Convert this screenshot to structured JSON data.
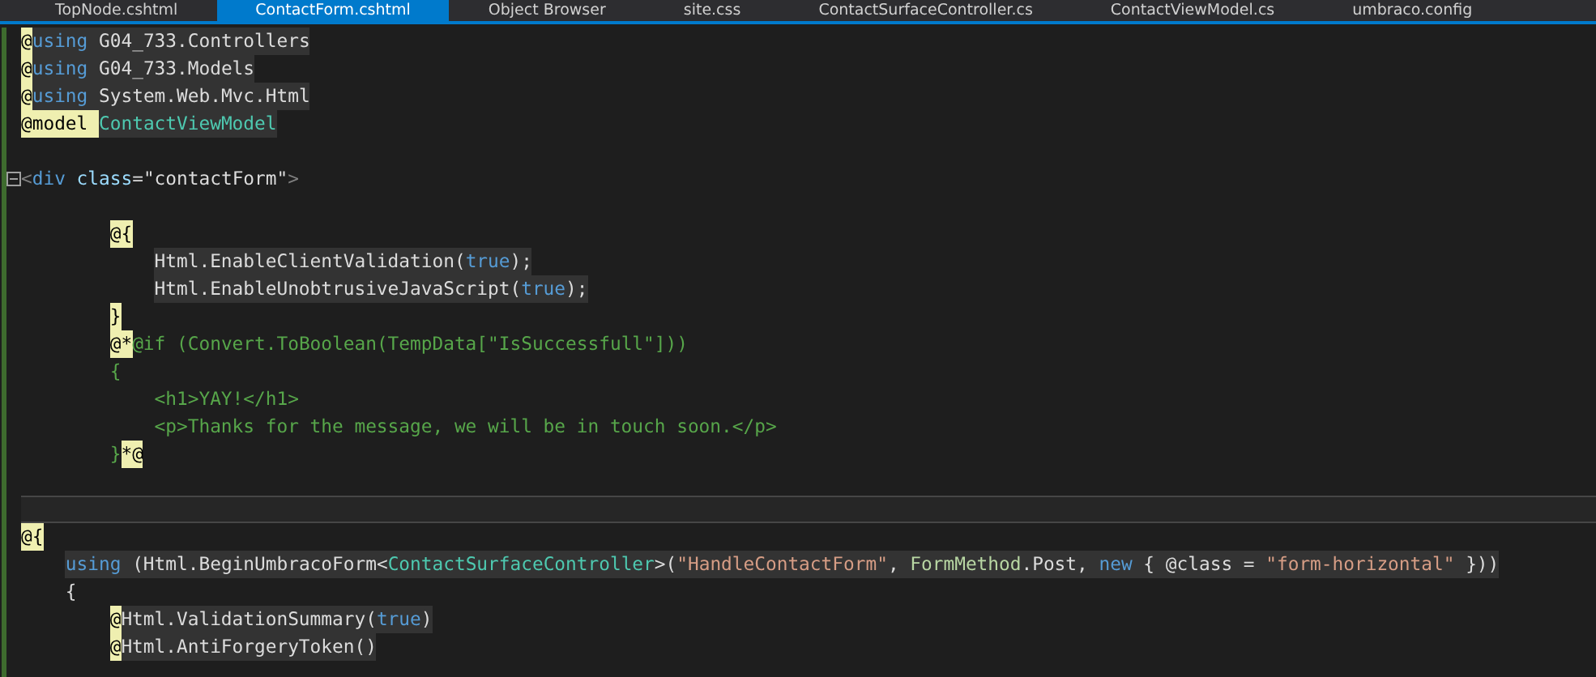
{
  "tabs": [
    {
      "label": "TopNode.cshtml",
      "selected": false
    },
    {
      "label": "ContactForm.cshtml",
      "selected": true
    },
    {
      "label": "Object Browser",
      "selected": false
    },
    {
      "label": "site.css",
      "selected": false
    },
    {
      "label": "ContactSurfaceController.cs",
      "selected": false
    },
    {
      "label": "ContactViewModel.cs",
      "selected": false
    },
    {
      "label": "umbraco.config",
      "selected": false
    }
  ],
  "lines": [
    {
      "fold": false,
      "current": false,
      "tokens": [
        {
          "kind": "razor",
          "text": "@"
        },
        {
          "kind": "keyword",
          "text": "using",
          "shaded": true
        },
        {
          "kind": "plain",
          "text": " G04_733.Controllers",
          "shaded": true
        }
      ]
    },
    {
      "fold": false,
      "current": false,
      "tokens": [
        {
          "kind": "razor",
          "text": "@"
        },
        {
          "kind": "keyword",
          "text": "using",
          "shaded": true
        },
        {
          "kind": "plain",
          "text": " G04_733.Models",
          "shaded": true
        }
      ]
    },
    {
      "fold": false,
      "current": false,
      "tokens": [
        {
          "kind": "razor",
          "text": "@"
        },
        {
          "kind": "keyword",
          "text": "using",
          "shaded": true
        },
        {
          "kind": "plain",
          "text": " System.Web.Mvc.Html",
          "shaded": true
        }
      ]
    },
    {
      "fold": false,
      "current": false,
      "tokens": [
        {
          "kind": "razor",
          "text": "@model "
        },
        {
          "kind": "type",
          "text": "ContactViewModel",
          "shaded": true
        }
      ]
    },
    {
      "fold": false,
      "current": false
    },
    {
      "fold": true,
      "current": false,
      "tokens": [
        {
          "kind": "delimiter",
          "text": "<"
        },
        {
          "kind": "tag",
          "text": "div"
        },
        {
          "kind": "attr",
          "text": " class"
        },
        {
          "kind": "plain",
          "text": "=\"contactForm\""
        },
        {
          "kind": "delimiter",
          "text": ">"
        }
      ],
      "children": [
        {
          "fold": false,
          "current": false
        },
        {
          "fold": false,
          "current": false,
          "tokens": [
            {
              "kind": "razor",
              "text": "@{"
            }
          ],
          "children": [
            {
              "fold": false,
              "current": false,
              "tokens": [
                {
                  "kind": "plain",
                  "text": "Html.EnableClientValidation(",
                  "shaded": true
                },
                {
                  "kind": "keyword",
                  "text": "true",
                  "shaded": true
                },
                {
                  "kind": "plain",
                  "text": ");",
                  "shaded": true
                }
              ]
            },
            {
              "fold": false,
              "current": false,
              "tokens": [
                {
                  "kind": "plain",
                  "text": "Html.EnableUnobtrusiveJavaScript(",
                  "shaded": true
                },
                {
                  "kind": "keyword",
                  "text": "true",
                  "shaded": true
                },
                {
                  "kind": "plain",
                  "text": ");",
                  "shaded": true
                }
              ]
            }
          ]
        },
        {
          "fold": false,
          "current": false,
          "tokens": [
            {
              "kind": "razor",
              "text": "}"
            }
          ]
        },
        {
          "fold": false,
          "current": false,
          "tokens": [
            {
              "kind": "razor",
              "text": "@*"
            },
            {
              "kind": "comment",
              "text": "@if (Convert.ToBoolean(TempData[\"IsSuccessfull\"]))"
            }
          ]
        },
        {
          "fold": false,
          "current": false,
          "tokens": [
            {
              "kind": "comment",
              "text": "{"
            }
          ],
          "children": [
            {
              "fold": false,
              "current": false,
              "tokens": [
                {
                  "kind": "comment",
                  "text": "<h1>YAY!</h1>"
                }
              ]
            },
            {
              "fold": false,
              "current": false,
              "tokens": [
                {
                  "kind": "comment",
                  "text": "<p>Thanks for the message, we will be in touch soon.</p>"
                }
              ]
            }
          ]
        },
        {
          "fold": false,
          "current": false,
          "tokens": [
            {
              "kind": "comment",
              "text": "}"
            },
            {
              "kind": "razor",
              "text": "*@"
            }
          ]
        }
      ]
    },
    {
      "fold": false,
      "current": false
    },
    {
      "fold": false,
      "current": true
    },
    {
      "fold": false,
      "current": false,
      "tokens": [
        {
          "kind": "razor",
          "text": "@{"
        }
      ],
      "children": [
        {
          "fold": false,
          "current": false,
          "tokens": [
            {
              "kind": "keyword",
              "text": "using",
              "shaded": true
            },
            {
              "kind": "plain",
              "text": " (Html.BeginUmbracoForm<",
              "shaded": true
            },
            {
              "kind": "type",
              "text": "ContactSurfaceController",
              "shaded": true
            },
            {
              "kind": "plain",
              "text": ">(",
              "shaded": true
            },
            {
              "kind": "string",
              "text": "\"HandleContactForm\"",
              "shaded": true
            },
            {
              "kind": "plain",
              "text": ", ",
              "shaded": true
            },
            {
              "kind": "method",
              "text": "FormMethod",
              "shaded": true
            },
            {
              "kind": "plain",
              "text": ".Post, ",
              "shaded": true
            },
            {
              "kind": "keyword",
              "text": "new",
              "shaded": true
            },
            {
              "kind": "plain",
              "text": " { @class = ",
              "shaded": true
            },
            {
              "kind": "string",
              "text": "\"form-horizontal\"",
              "shaded": true
            },
            {
              "kind": "plain",
              "text": " }))",
              "shaded": true
            }
          ]
        },
        {
          "fold": false,
          "current": false,
          "tokens": [
            {
              "kind": "plain",
              "text": "{"
            }
          ],
          "children": [
            {
              "fold": false,
              "current": false,
              "tokens": [
                {
                  "kind": "razor",
                  "text": "@"
                },
                {
                  "kind": "plain",
                  "text": "Html.ValidationSummary(",
                  "shaded": true
                },
                {
                  "kind": "keyword",
                  "text": "true",
                  "shaded": true
                },
                {
                  "kind": "plain",
                  "text": ")",
                  "shaded": true
                }
              ]
            },
            {
              "fold": false,
              "current": false,
              "tokens": [
                {
                  "kind": "razor",
                  "text": "@"
                },
                {
                  "kind": "plain",
                  "text": "Html.AntiForgeryToken()",
                  "shaded": true
                }
              ]
            }
          ]
        }
      ]
    }
  ]
}
